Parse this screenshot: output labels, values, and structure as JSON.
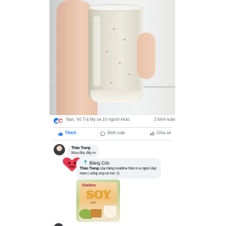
{
  "post": {
    "photo_alt": "",
    "reaction_names": "Bạn, Vũ Trà My và 10 người khác",
    "comment_count": "3 bình luận",
    "colors": {
      "accent": "#1877f2",
      "heart": "#f33e58",
      "tag": "#1aa6b7"
    }
  },
  "actions": {
    "like_label": "Thích",
    "comment_label": "Bình luận",
    "share_label": "Chia sẻ"
  },
  "comments": [
    {
      "author": "Thảo Trang",
      "text": "Mua đầu đấy m"
    }
  ],
  "reply": {
    "tag_icon": "location-pin-icon",
    "tag_label": "Băng Cốc",
    "author": "Thảo Trang",
    "text": "của hãng ovaltine thái m a ngon daz man ( uống xog no lun :))"
  },
  "product": {
    "brand": "Ovaltine",
    "name": "SOY",
    "sub": "Malt"
  }
}
